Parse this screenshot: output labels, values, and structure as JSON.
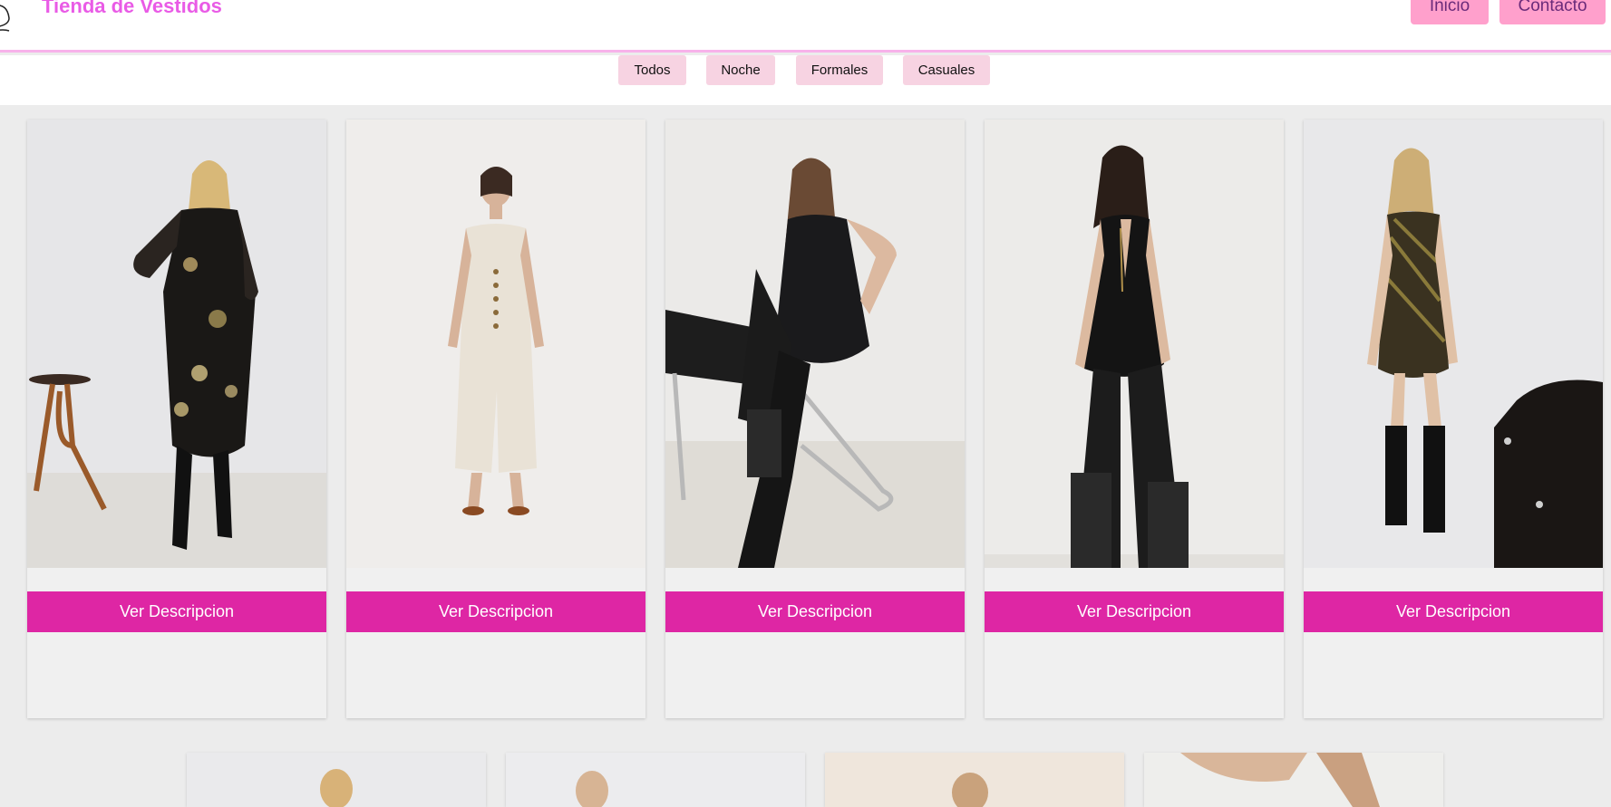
{
  "header": {
    "brand": "Tienda de Vestidos",
    "nav": [
      {
        "label": "Inicio"
      },
      {
        "label": "Contacto"
      }
    ]
  },
  "filters": [
    {
      "label": "Todos"
    },
    {
      "label": "Noche"
    },
    {
      "label": "Formales"
    },
    {
      "label": "Casuales"
    }
  ],
  "products": [
    {
      "button_label": "Ver Descripcion",
      "image": "floral-midi-dress-photo"
    },
    {
      "button_label": "Ver Descripcion",
      "image": "cream-jumpsuit-photo"
    },
    {
      "button_label": "Ver Descripcion",
      "image": "black-sequin-romper-photo"
    },
    {
      "button_label": "Ver Descripcion",
      "image": "black-wrap-dress-photo"
    },
    {
      "button_label": "Ver Descripcion",
      "image": "beaded-slip-dress-photo"
    }
  ],
  "colors": {
    "brand": "#e95be6",
    "nav_button": "#ffa0cc",
    "filter_button": "#f7d3e2",
    "card_button": "#de26a4",
    "header_border": "#f7b2ea"
  }
}
